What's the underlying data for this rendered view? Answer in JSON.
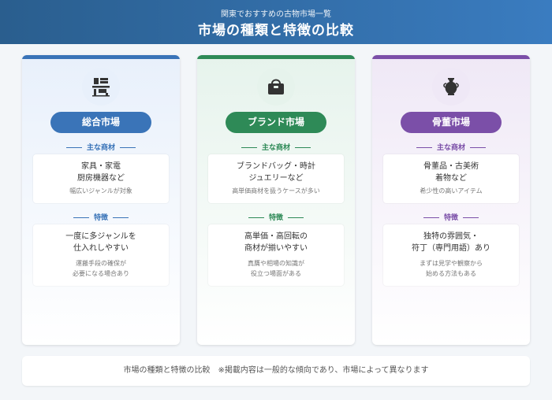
{
  "header": {
    "subtitle": "関東でおすすめの古物市場一覧",
    "title": "市場の種類と特徴の比較"
  },
  "cards": [
    {
      "name": "総合市場",
      "accent": "#3a74b8",
      "tint": "#e8f0fb",
      "icon": "store-icon",
      "section_products": "主な商材",
      "products_main": [
        "家具・家電",
        "厨房機器など"
      ],
      "products_note": "幅広いジャンルが対象",
      "section_features": "特徴",
      "features_main": [
        "一度に多ジャンルを",
        "仕入れしやすい"
      ],
      "features_note": [
        "運搬手段の確保が",
        "必要になる場合あり"
      ]
    },
    {
      "name": "ブランド市場",
      "accent": "#2e8a57",
      "tint": "#e6f3ec",
      "icon": "handbag-icon",
      "section_products": "主な商材",
      "products_main": [
        "ブランドバッグ・時計",
        "ジュエリーなど"
      ],
      "products_note": "高単価商材を扱うケースが多い",
      "section_features": "特徴",
      "features_main": [
        "高単価・高回転の",
        "商材が揃いやすい"
      ],
      "features_note": [
        "真贋や相場の知識が",
        "役立つ場面がある"
      ]
    },
    {
      "name": "骨董市場",
      "accent": "#7b4fa8",
      "tint": "#efe8f6",
      "icon": "vase-icon",
      "section_products": "主な商材",
      "products_main": [
        "骨董品・古美術",
        "着物など"
      ],
      "products_note": "希少性の高いアイテム",
      "section_features": "特徴",
      "features_main": [
        "独特の雰囲気・",
        "符丁（専門用語）あり"
      ],
      "features_note": [
        "まずは見学や観察から",
        "始める方法もある"
      ]
    }
  ],
  "footer": {
    "text": "市場の種類と特徴の比較　※掲載内容は一般的な傾向であり、市場によって異なります"
  }
}
